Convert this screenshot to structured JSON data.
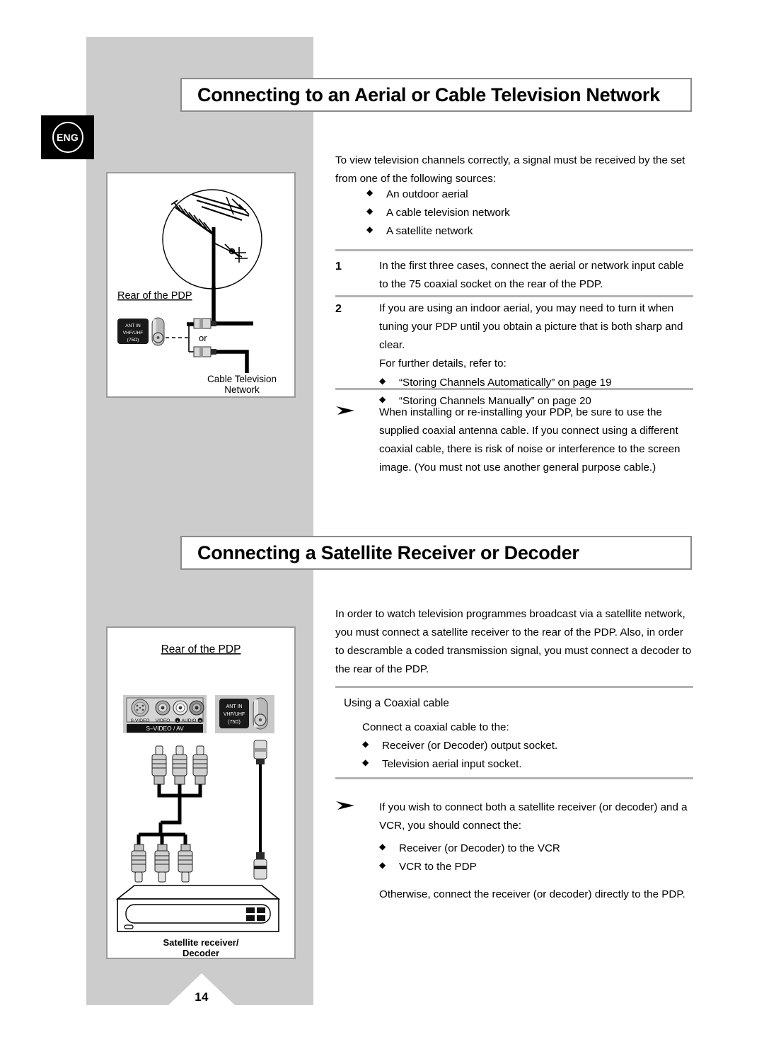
{
  "page": {
    "number": "14",
    "language_badge": "ENG"
  },
  "sections": [
    {
      "heading": "Connecting to an Aerial or Cable Television Network",
      "intro": "To view television channels correctly, a signal must be received by the set from one of the following sources:",
      "source_bullets": [
        "An outdoor aerial",
        "A cable television network",
        "A satellite network"
      ],
      "steps": [
        {
          "number": "1",
          "text": "In the first three cases, connect the aerial or network input cable to the 75   coaxial socket on the rear of the PDP."
        },
        {
          "number": "2",
          "text": "If you are using an indoor aerial, you may need to turn it when tuning your PDP until you obtain a picture that is both sharp and clear.",
          "followup": "For further details, refer to:",
          "bullets": [
            "“Storing Channels Automatically” on page 19",
            "“Storing Channels Manually” on page 20"
          ]
        }
      ],
      "note": "When installing or re-installing your PDP, be sure to use the supplied coaxial antenna cable. If you connect using a different coaxial cable, there is risk of noise or interference to the screen image. (You must not use another general purpose cable.)"
    },
    {
      "heading": "Connecting a Satellite Receiver or Decoder",
      "intro": "In order to watch television programmes broadcast via a satellite network, you must connect a satellite receiver to the rear of the PDP. Also, in order to descramble a coded transmission signal, you must connect a decoder to the rear of the PDP.",
      "sub_heading": "Using a Coaxial cable",
      "instruction": "Connect a coaxial cable to the:",
      "instruction_bullets": [
        "Receiver (or Decoder) output socket.",
        "Television aerial input socket."
      ],
      "note": "If you wish to connect both a satellite receiver (or decoder) and a VCR, you should connect the:",
      "note_bullets": [
        "Receiver (or Decoder) to the VCR",
        "VCR to the PDP"
      ],
      "note_tail": "Otherwise, connect the receiver (or decoder) directly to the PDP."
    }
  ],
  "figure_aerial": {
    "rear_label": "Rear of the PDP",
    "socket_label_line1": "ANT IN",
    "socket_label_line2": "VHF/UHF",
    "socket_label_line3": "(75Ω)",
    "or_label": "or",
    "caption_line1": "Cable Television",
    "caption_line2": "Network"
  },
  "figure_satellite": {
    "rear_label": "Rear of the PDP",
    "av_panel": {
      "labels": [
        "S-VIDEO",
        "VIDEO",
        "AUDIO"
      ],
      "audio_left": "L",
      "audio_right": "R",
      "bar_label": "S–VIDEO / AV"
    },
    "ant_panel": {
      "line1": "ANT IN",
      "line2": "VHF/UHF",
      "line3": "(75Ω)"
    },
    "caption_line1": "Satellite receiver/",
    "caption_line2": "Decoder"
  },
  "symbols": {
    "diamond": "◆",
    "arrow": "➤"
  },
  "colors": {
    "band_grey": "#cccccc",
    "rule_grey": "#b3b3b3",
    "heading_border": "#8a8a8a",
    "badge_black": "#000000"
  }
}
